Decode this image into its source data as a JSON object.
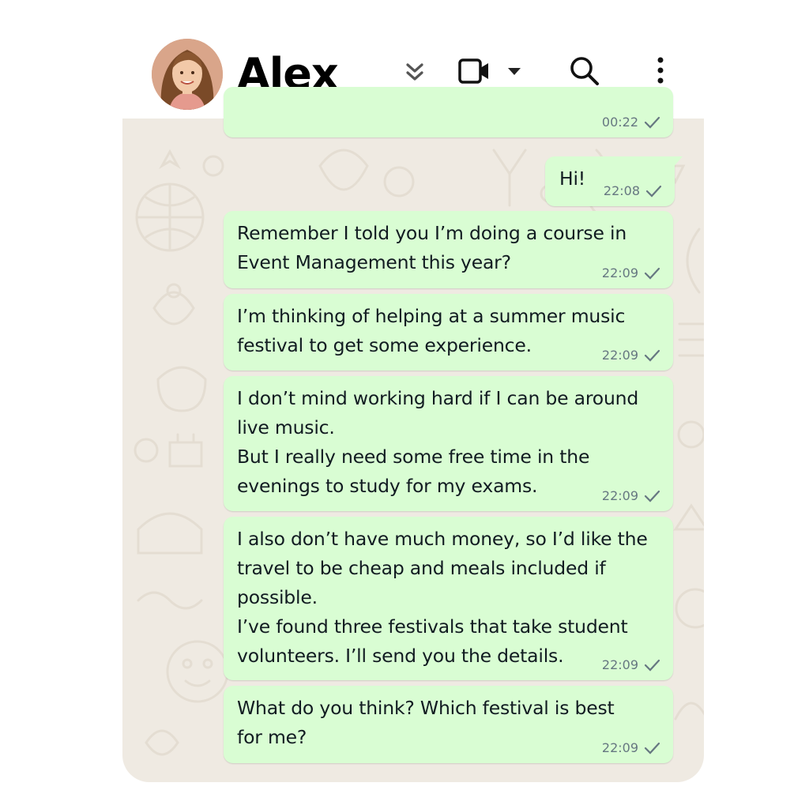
{
  "contact": {
    "name": "Alex"
  },
  "header_icons": [
    "chevrons-down-icon",
    "video-camera-icon",
    "dropdown-caret-icon",
    "search-icon",
    "more-vertical-icon"
  ],
  "colors": {
    "outgoing_bubble": "#d9fdd3",
    "chat_background": "#efeae2",
    "meta_text": "#667781"
  },
  "messages": [
    {
      "text": "",
      "time": "00:22"
    },
    {
      "text": "Hi!",
      "time": "22:08"
    },
    {
      "text": "Remember I told you I’m doing a course in\nEvent Management this year?",
      "time": "22:09"
    },
    {
      "text": "I’m thinking of helping at a summer music\nfestival to get some experience.",
      "time": "22:09"
    },
    {
      "text": "I don’t mind working hard if I can be around\nlive music.\nBut I really need some free time in the\nevenings to study for my exams.",
      "time": "22:09"
    },
    {
      "text": "I also don’t have much money, so I’d like the\ntravel to be cheap and meals included if\npossible.\nI’ve found three festivals that take student\nvolunteers. I’ll send you the details.",
      "time": "22:09"
    },
    {
      "text": "What do you think? Which festival is best\nfor me?",
      "time": "22:09"
    }
  ]
}
